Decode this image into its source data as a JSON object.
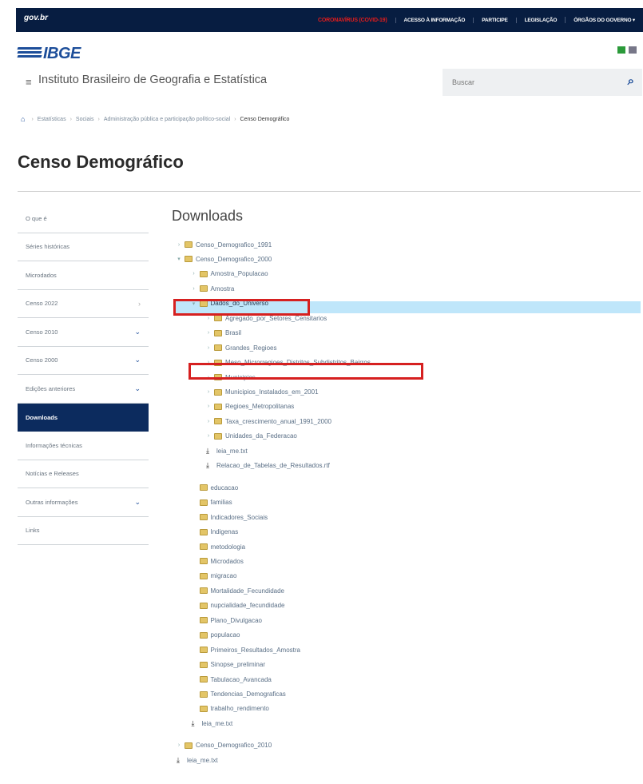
{
  "govbar": {
    "gov_label": "gov.br",
    "nav": [
      "CORONAVÍRUS (COVID-19)",
      "ACESSO À INFORMAÇÃO",
      "PARTICIPE",
      "LEGISLAÇÃO",
      "ÓRGÃOS DO GOVERNO ▾"
    ]
  },
  "header": {
    "logo": "IBGE",
    "institution": "Instituto Brasileiro de Geografia e Estatística",
    "search_placeholder": "Buscar"
  },
  "breadcrumb": [
    "Estatísticas",
    "Sociais",
    "Administração pública e participação político-social",
    "Censo Demográfico"
  ],
  "page_title": "Censo Demográfico",
  "sidebar": {
    "items": [
      {
        "label": "O que é",
        "marker": ""
      },
      {
        "label": "Séries históricas",
        "marker": ""
      },
      {
        "label": "Microdados",
        "marker": ""
      },
      {
        "label": "Censo 2022",
        "marker": "›"
      },
      {
        "label": "Censo 2010",
        "marker": "⌄"
      },
      {
        "label": "Censo 2000",
        "marker": "⌄"
      },
      {
        "label": "Edições anteriores",
        "marker": "⌄"
      },
      {
        "label": "Downloads",
        "marker": "",
        "active": true
      },
      {
        "label": "Informações técnicas",
        "marker": ""
      },
      {
        "label": "Notícias e Releases",
        "marker": ""
      },
      {
        "label": "Outras informações",
        "marker": "⌄"
      },
      {
        "label": "Links",
        "marker": ""
      }
    ]
  },
  "content": {
    "title": "Downloads",
    "tree": [
      {
        "type": "folder",
        "level": 0,
        "toggle": "›",
        "label": "Censo_Demografico_1991"
      },
      {
        "type": "folder",
        "level": 0,
        "toggle": "▾",
        "label": "Censo_Demografico_2000"
      },
      {
        "type": "folder",
        "level": 1,
        "toggle": "›",
        "label": "Amostra_Populacao"
      },
      {
        "type": "folder",
        "level": 1,
        "toggle": "›",
        "label": "Amostra"
      },
      {
        "type": "folder",
        "level": 1,
        "toggle": "▾",
        "label": "Dados_do_Universo",
        "selected": true
      },
      {
        "type": "folder",
        "level": 2,
        "toggle": "›",
        "label": "Agregado_por_Setores_Censitarios"
      },
      {
        "type": "folder",
        "level": 2,
        "toggle": "›",
        "label": "Brasil"
      },
      {
        "type": "folder",
        "level": 2,
        "toggle": "›",
        "label": "Grandes_Regioes"
      },
      {
        "type": "folder",
        "level": 2,
        "toggle": "›",
        "label": "Meso_Microrregioes_Distritos_Subdistritos_Bairros"
      },
      {
        "type": "folder",
        "level": 2,
        "toggle": "›",
        "label": "Municipios"
      },
      {
        "type": "folder",
        "level": 2,
        "toggle": "›",
        "label": "Municipios_Instalados_em_2001"
      },
      {
        "type": "folder",
        "level": 2,
        "toggle": "›",
        "label": "Regioes_Metropolitanas"
      },
      {
        "type": "folder",
        "level": 2,
        "toggle": "›",
        "label": "Taxa_crescimento_anual_1991_2000"
      },
      {
        "type": "folder",
        "level": 2,
        "toggle": "›",
        "label": "Unidades_da_Federacao"
      },
      {
        "type": "file",
        "level": 2,
        "label": "leia_me.txt"
      },
      {
        "type": "file",
        "level": 2,
        "label": "Relacao_de_Tabelas_de_Resultados.rtf"
      },
      {
        "type": "gap"
      },
      {
        "type": "folder",
        "level": 1,
        "label": "educacao"
      },
      {
        "type": "folder",
        "level": 1,
        "label": "familias"
      },
      {
        "type": "folder",
        "level": 1,
        "label": "Indicadores_Sociais"
      },
      {
        "type": "folder",
        "level": 1,
        "label": "Indigenas"
      },
      {
        "type": "folder",
        "level": 1,
        "label": "metodologia"
      },
      {
        "type": "folder",
        "level": 1,
        "label": "Microdados"
      },
      {
        "type": "folder",
        "level": 1,
        "label": "migracao"
      },
      {
        "type": "folder",
        "level": 1,
        "label": "Mortalidade_Fecundidade"
      },
      {
        "type": "folder",
        "level": 1,
        "label": "nupcialidade_fecundidade"
      },
      {
        "type": "folder",
        "level": 1,
        "label": "Plano_Divulgacao"
      },
      {
        "type": "folder",
        "level": 1,
        "label": "populacao"
      },
      {
        "type": "folder",
        "level": 1,
        "label": "Primeiros_Resultados_Amostra"
      },
      {
        "type": "folder",
        "level": 1,
        "label": "Sinopse_preliminar"
      },
      {
        "type": "folder",
        "level": 1,
        "label": "Tabulacao_Avancada"
      },
      {
        "type": "folder",
        "level": 1,
        "label": "Tendencias_Demograficas"
      },
      {
        "type": "folder",
        "level": 1,
        "label": "trabalho_rendimento"
      },
      {
        "type": "file",
        "level": 1,
        "label": "leia_me.txt"
      },
      {
        "type": "gap"
      },
      {
        "type": "folder",
        "level": 0,
        "toggle": "›",
        "label": "Censo_Demografico_2010"
      },
      {
        "type": "file",
        "level": 0,
        "label": "leia_me.txt"
      }
    ]
  },
  "colors": {
    "navy": "#071d41",
    "brand_blue": "#1d4e9a",
    "active_sidebar": "#0c2b5e",
    "selected_row": "#bfe6fa",
    "annotation_red": "#d62020"
  }
}
